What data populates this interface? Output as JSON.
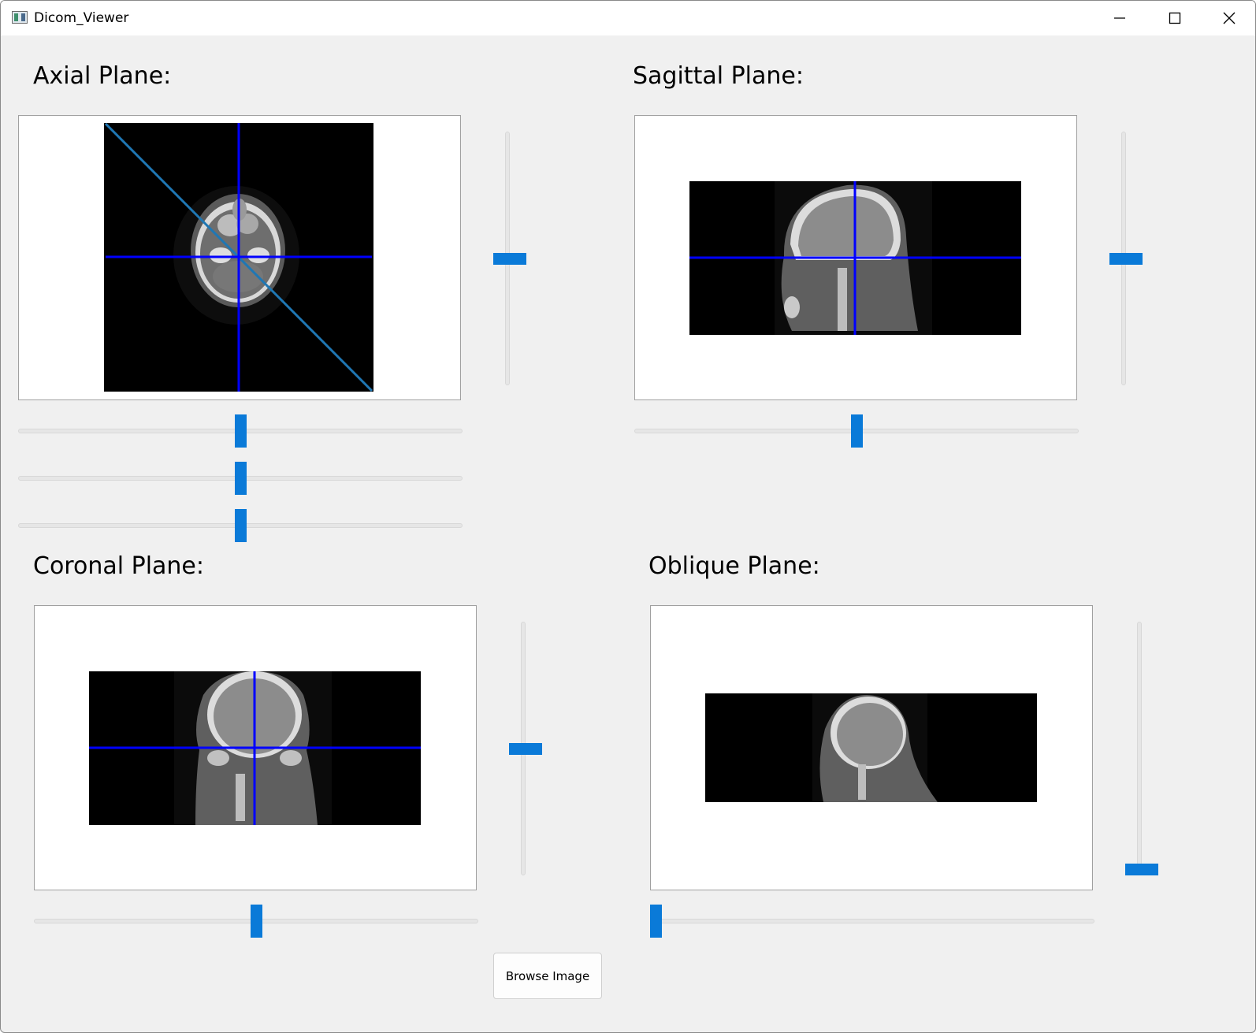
{
  "window": {
    "title": "Dicom_Viewer"
  },
  "planes": {
    "axial": {
      "label": "Axial Plane:"
    },
    "sagittal": {
      "label": "Sagittal Plane:"
    },
    "coronal": {
      "label": "Coronal Plane:"
    },
    "oblique": {
      "label": "Oblique Plane:"
    }
  },
  "sliders": {
    "axial_vertical": 0.5,
    "axial_horizontal_1": 0.5,
    "axial_horizontal_2": 0.5,
    "axial_horizontal_3": 0.5,
    "sagittal_vertical": 0.5,
    "sagittal_horizontal": 0.5,
    "coronal_vertical": 0.5,
    "coronal_horizontal": 0.5,
    "oblique_vertical": 0.0,
    "oblique_horizontal": 0.0
  },
  "buttons": {
    "browse": "Browse Image"
  },
  "colors": {
    "crosshair": "#0000ff",
    "oblique_line": "#1f77b4",
    "slider_thumb": "#0a7ad8"
  }
}
